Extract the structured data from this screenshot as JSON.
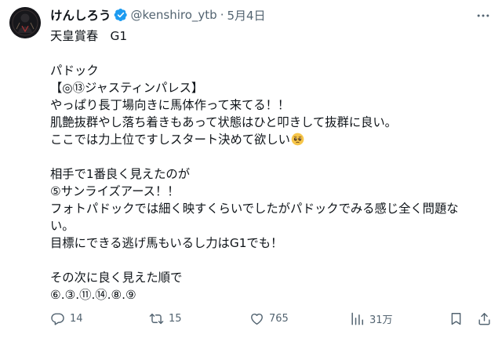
{
  "author": {
    "display_name": "けんしろう",
    "handle": "@kenshiro_ytb",
    "separator": "·",
    "date": "5月4日",
    "verified": true,
    "avatar_icon": "avatar-image"
  },
  "tweet": {
    "lines": [
      "天皇賞春　G1",
      "",
      "パドック",
      "【◎⑬ジャスティンパレス】",
      "やっぱり長丁場向きに馬体作って来てる！！",
      "肌艶抜群やし落ち着きもあって状態はひと叩きして抜群に良い。",
      "ここでは力上位ですしスタート決めて欲しい",
      "",
      "相手で1番良く見えたのが",
      "⑤サンライズアース！！",
      "フォトパドックでは細く映すくらいでしたがパドックでみる感じ全く問題な",
      "い。",
      "目標にできる逃げ馬もいるし力はG1でも！",
      "",
      "その次に良く見えた順で",
      "⑥.③.⑪.⑭.⑧.⑨"
    ],
    "emoji": "pleading-face-emoji"
  },
  "actions": {
    "reply": {
      "icon": "reply-icon",
      "count": "14"
    },
    "retweet": {
      "icon": "retweet-icon",
      "count": "15"
    },
    "like": {
      "icon": "heart-icon",
      "count": "765"
    },
    "views": {
      "icon": "views-chart-icon",
      "count": "31万"
    },
    "bookmark": {
      "icon": "bookmark-icon"
    },
    "share": {
      "icon": "share-icon"
    }
  },
  "colors": {
    "text": "#0f1419",
    "secondary": "#536471",
    "verified": "#1d9bf0",
    "background": "#ffffff"
  }
}
